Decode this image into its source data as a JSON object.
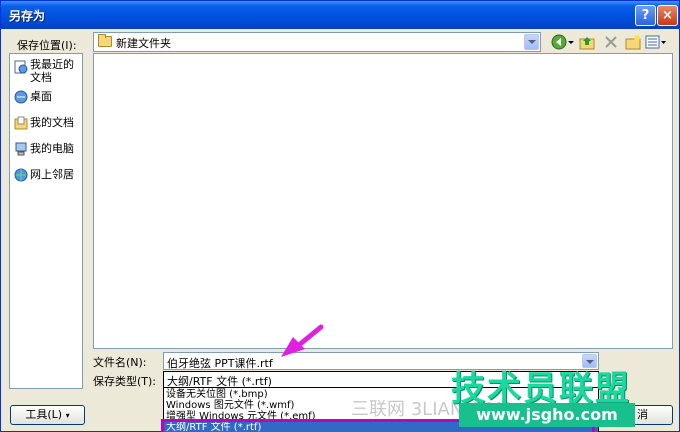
{
  "window": {
    "title": "另存为",
    "help_label": "?",
    "close_label": "×"
  },
  "save_in": {
    "label": "保存位置(I):",
    "value": "新建文件夹"
  },
  "places": [
    {
      "label": "我最近的文档",
      "icon": "recent-docs-icon"
    },
    {
      "label": "桌面",
      "icon": "desktop-icon"
    },
    {
      "label": "我的文档",
      "icon": "my-documents-icon"
    },
    {
      "label": "我的电脑",
      "icon": "my-computer-icon"
    },
    {
      "label": "网上邻居",
      "icon": "network-places-icon"
    }
  ],
  "filename": {
    "label": "文件名(N):",
    "value": "伯牙绝弦 PPT课件.rtf"
  },
  "filetype": {
    "label": "保存类型(T):",
    "value": "大纲/RTF 文件 (*.rtf)",
    "options": [
      "设备无关位图 (*.bmp)",
      "Windows 图元文件 (*.wmf)",
      "增强型 Windows 元文件 (*.emf)",
      "大纲/RTF 文件 (*.rtf)"
    ],
    "selected_index": 3
  },
  "buttons": {
    "tools": "工具(L)",
    "cancel": "消"
  },
  "watermark": {
    "brand": "技术员联盟",
    "url": "www.jsgho.com",
    "gray": "三联网 3LIAN.COM"
  },
  "colors": {
    "titlebar": "#0054e3",
    "selection": "#316ac5",
    "highlight": "#c000c0",
    "watermark": "#19d8a0"
  }
}
